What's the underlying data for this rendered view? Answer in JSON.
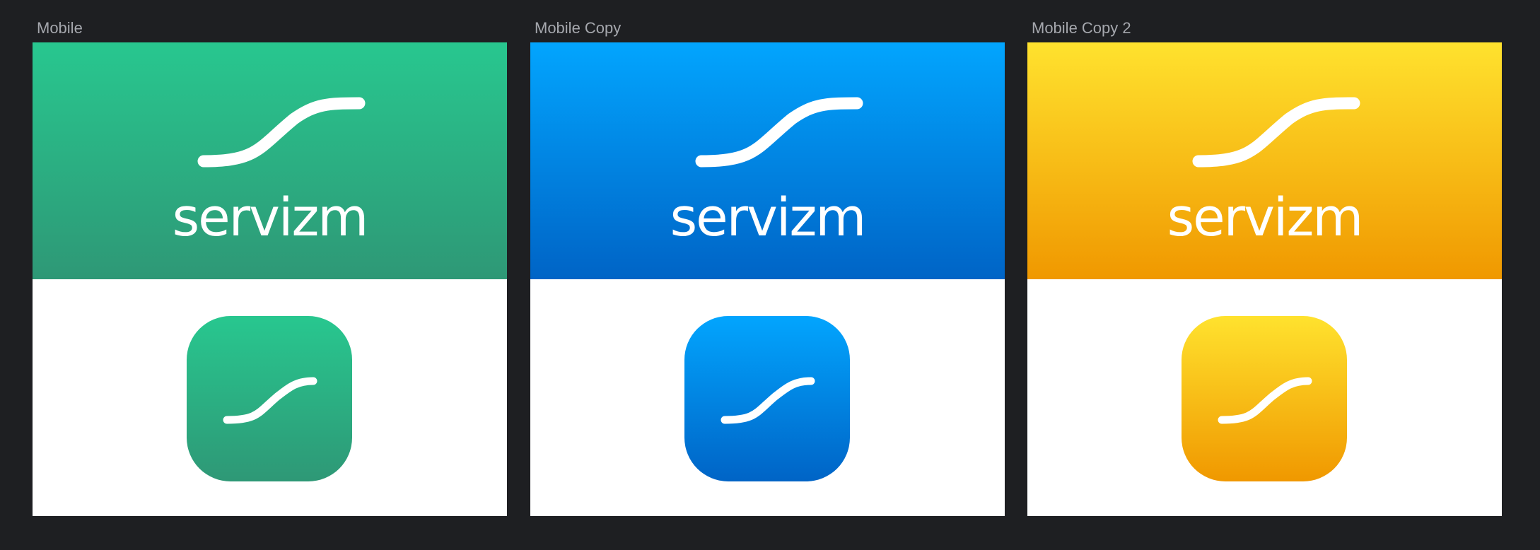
{
  "artboards": [
    {
      "label": "Mobile",
      "wordmark": "servizm",
      "gradient": {
        "top": "#28c78f",
        "bottom": "#2e9876"
      }
    },
    {
      "label": "Mobile Copy",
      "wordmark": "servizm",
      "gradient": {
        "top": "#02a5fe",
        "bottom": "#0064c6"
      }
    },
    {
      "label": "Mobile Copy 2",
      "wordmark": "servizm",
      "gradient": {
        "top": "#ffe22e",
        "bottom": "#f09800"
      }
    }
  ],
  "colors": {
    "canvas_background": "#1e1f22",
    "label_text": "#a5a7ad",
    "artboard_background": "#ffffff",
    "logo_stroke": "#ffffff"
  },
  "icons": {
    "banner_logo": "s-curve-logo-icon",
    "app_icon": "s-curve-app-icon"
  }
}
